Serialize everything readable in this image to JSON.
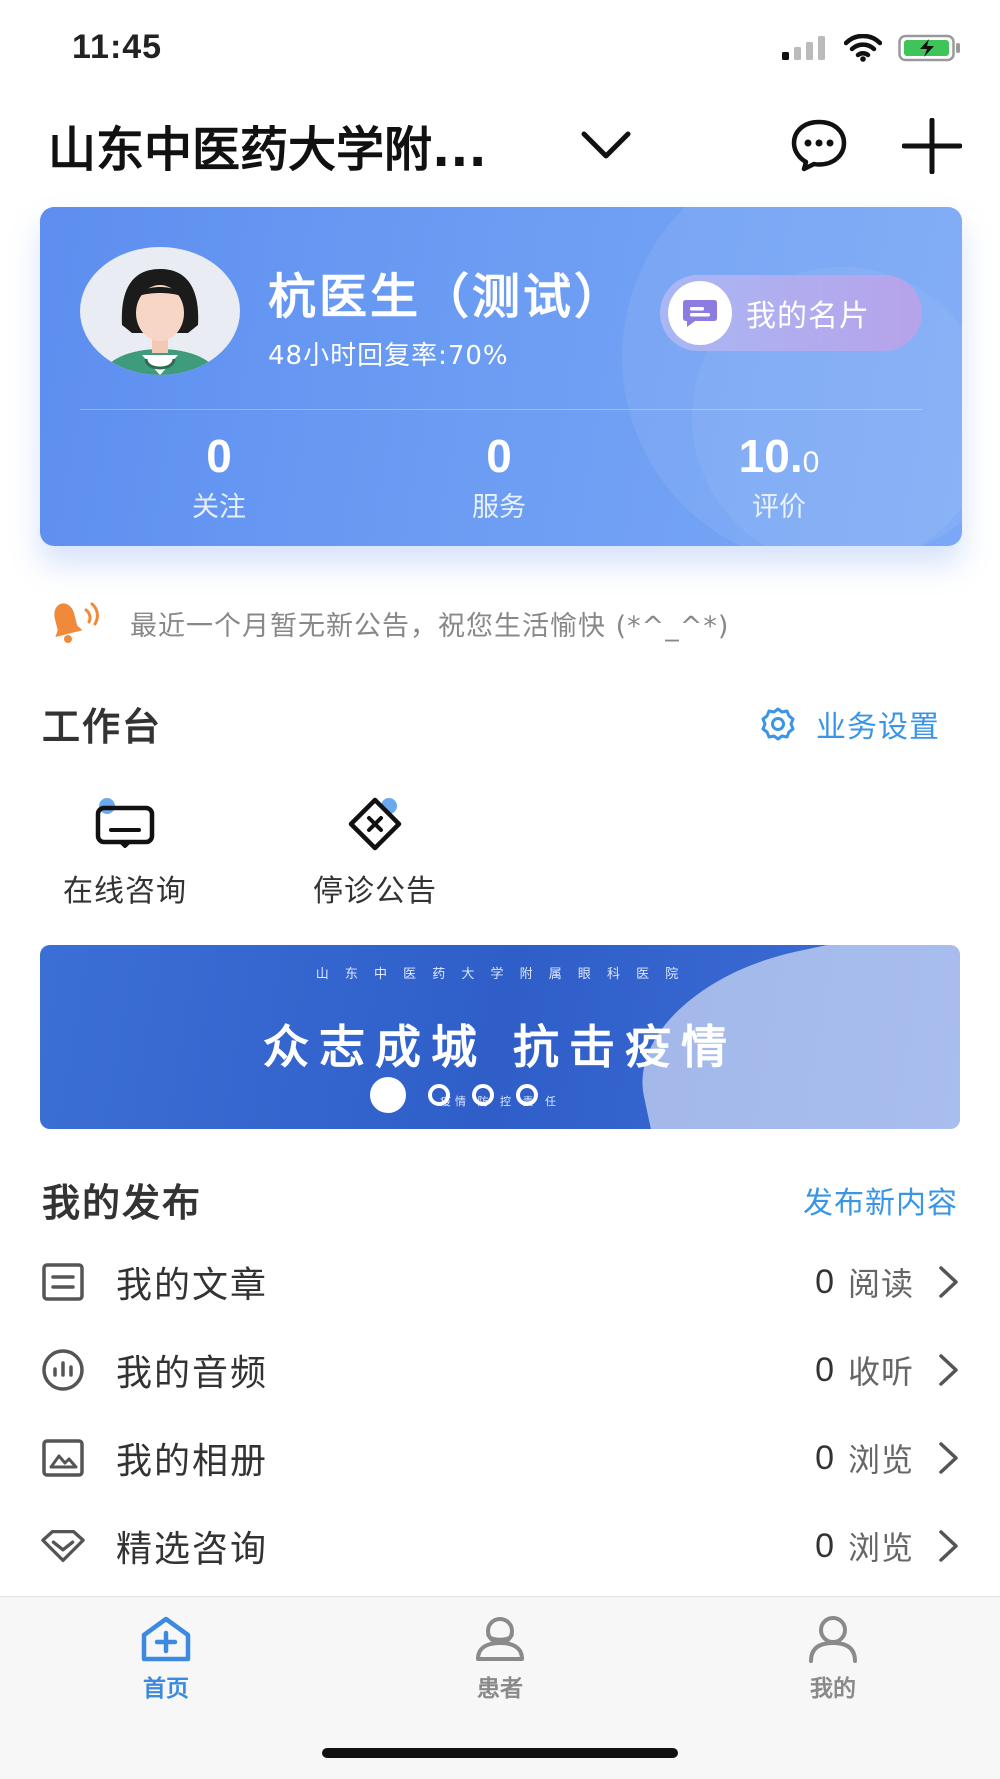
{
  "status": {
    "time": "11:45"
  },
  "header": {
    "hospital": "山东中医药大学附..."
  },
  "profile": {
    "name": "杭医生（测试）",
    "reply_rate": "48小时回复率:70%",
    "card_button": "我的名片",
    "stats": [
      {
        "value": "0",
        "label": "关注"
      },
      {
        "value": "0",
        "label": "服务"
      },
      {
        "value_main": "10.",
        "value_small": "0",
        "label": "评价"
      }
    ]
  },
  "notice": {
    "text": "最近一个月暂无新公告，祝您生活愉快 (*^_^*)"
  },
  "workspace": {
    "title": "工作台",
    "settings_link": "业务设置",
    "items": [
      {
        "label": "在线咨询",
        "icon": "chat-screen-icon"
      },
      {
        "label": "停诊公告",
        "icon": "diamond-close-icon"
      }
    ]
  },
  "banner": {
    "top_text": "山 东 中 医 药 大 学 附 属 眼 科 医 院",
    "slogan": "众志成城  抗击疫情",
    "sub_text": "疫情 防 控 责 任",
    "slides": 4,
    "active_slide": 1
  },
  "publish": {
    "title": "我的发布",
    "new_link": "发布新内容",
    "rows": [
      {
        "label": "我的文章",
        "count": "0",
        "unit": "阅读",
        "icon": "article-icon"
      },
      {
        "label": "我的音频",
        "count": "0",
        "unit": "收听",
        "icon": "audio-icon"
      },
      {
        "label": "我的相册",
        "count": "0",
        "unit": "浏览",
        "icon": "album-icon"
      },
      {
        "label": "精选咨询",
        "count": "0",
        "unit": "浏览",
        "icon": "diamond-icon"
      }
    ]
  },
  "tabbar": {
    "items": [
      {
        "label": "首页",
        "active": true
      },
      {
        "label": "患者",
        "active": false
      },
      {
        "label": "我的",
        "active": false
      }
    ]
  },
  "colors": {
    "accent": "#3b95e6",
    "card": "#6b9cf3",
    "tab_active": "#3b8ae0",
    "tab_inactive": "#8a8a8a"
  }
}
